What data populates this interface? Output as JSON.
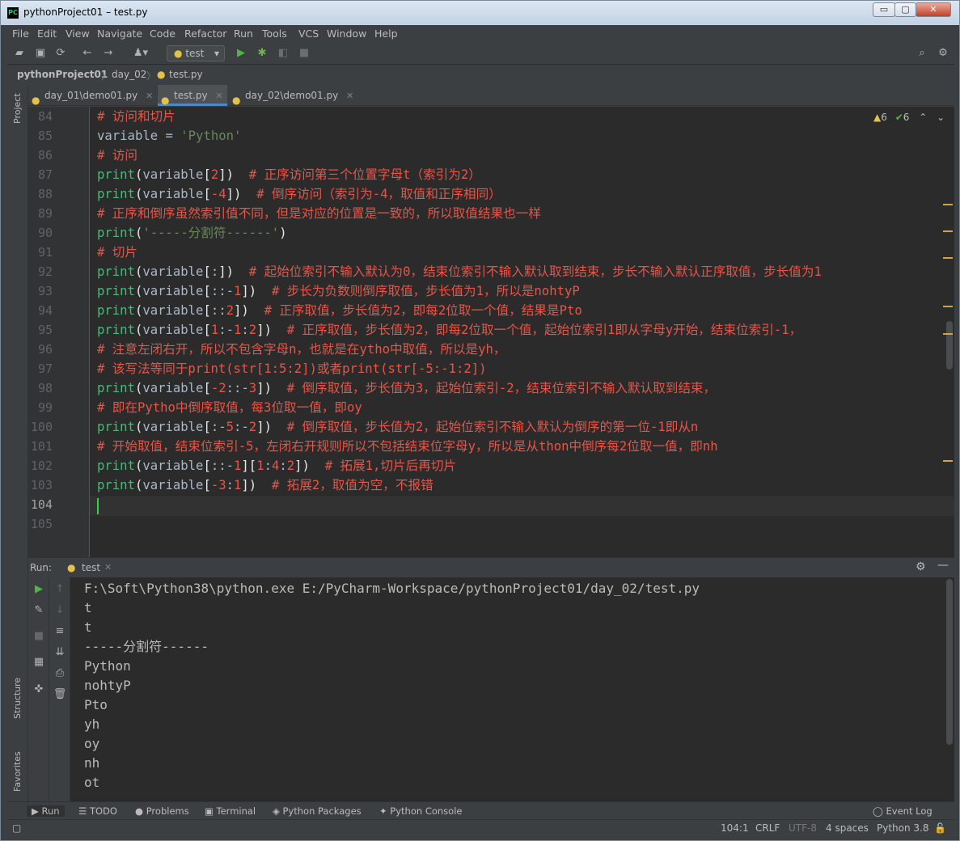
{
  "window": {
    "title": "pythonProject01 – test.py",
    "app_icon": "PC",
    "controls": {
      "minimize": "▭",
      "maximize": "▢",
      "close": "✕"
    }
  },
  "menu": [
    "File",
    "Edit",
    "View",
    "Navigate",
    "Code",
    "Refactor",
    "Run",
    "Tools",
    "VCS",
    "Window",
    "Help"
  ],
  "toolbar": {
    "run_config": "test"
  },
  "breadcrumb": [
    "pythonProject01",
    "day_02",
    "test.py"
  ],
  "tabs": [
    {
      "label": "day_01\\demo01.py"
    },
    {
      "label": "test.py"
    },
    {
      "label": "day_02\\demo01.py"
    }
  ],
  "side": {
    "project": "Project",
    "structure": "Structure",
    "favorites": "Favorites"
  },
  "inspections": {
    "warnings": "6",
    "weak_warnings": "6"
  },
  "editor": {
    "line_numbers": [
      "84",
      "85",
      "86",
      "87",
      "88",
      "89",
      "90",
      "91",
      "92",
      "93",
      "94",
      "95",
      "96",
      "97",
      "98",
      "99",
      "100",
      "101",
      "102",
      "103",
      "104",
      "105"
    ],
    "caret_line": "104",
    "code": [
      "# 访问和切片",
      "variable = 'Python'",
      "# 访问",
      "print(variable[2])  # 正序访问第三个位置字母t（索引为2）",
      "print(variable[-4])  # 倒序访问（索引为-4，取值和正序相同）",
      "# 正序和倒序虽然索引值不同，但是对应的位置是一致的，所以取值结果也一样",
      "print('-----分割符------')",
      "# 切片",
      "print(variable[:])  # 起始位索引不输入默认为0，结束位索引不输入默认取到结束，步长不输入默认正序取值，步长值为1",
      "print(variable[::-1])  # 步长为负数则倒序取值，步长值为1，所以是nohtyP",
      "print(variable[::2])  # 正序取值，步长值为2，即每2位取一个值，结果是Pto",
      "print(variable[1:-1:2])  # 正序取值，步长值为2，即每2位取一个值，起始位索引1即从字母y开始，结束位索引-1，",
      "# 注意左闭右开，所以不包含字母n，也就是在ytho中取值，所以是yh，",
      "# 该写法等同于print(str[1:5:2])或者print(str[-5:-1:2])",
      "print(variable[-2::-3])  # 倒序取值，步长值为3，起始位索引-2，结束位索引不输入默认取到结束，",
      "# 即在Pytho中倒序取值，每3位取一值，即oy",
      "print(variable[:-5:-2])  # 倒序取值，步长值为2，起始位索引不输入默认为倒序的第一位-1即从n",
      "# 开始取值，结束位索引-5，左闭右开规则所以不包括结束位字母y，所以是从thon中倒序每2位取一值，即nh",
      "print(variable[::-1][1:4:2])  # 拓展1,切片后再切片",
      "print(variable[-3:1])  # 拓展2，取值为空，不报错",
      "",
      ""
    ]
  },
  "run_panel": {
    "label": "Run:",
    "tab": "test",
    "command": "F:\\Soft\\Python38\\python.exe E:/PyCharm-Workspace/pythonProject01/day_02/test.py",
    "output": [
      "t",
      "t",
      "-----分割符------",
      "Python",
      "nohtyP",
      "Pto",
      "yh",
      "oy",
      "nh",
      "ot"
    ]
  },
  "bottom_tabs": [
    "Run",
    "TODO",
    "Problems",
    "Terminal",
    "Python Packages",
    "Python Console",
    "Event Log"
  ],
  "status": {
    "position": "104:1",
    "line_sep": "CRLF",
    "encoding": "UTF-8",
    "indent": "4 spaces",
    "interpreter": "Python 3.8"
  },
  "colors": {
    "bg": "#2b2b2b",
    "comment": "#e45649",
    "function": "#4ab87a",
    "string": "#6a8759",
    "caret": "#32d246"
  }
}
